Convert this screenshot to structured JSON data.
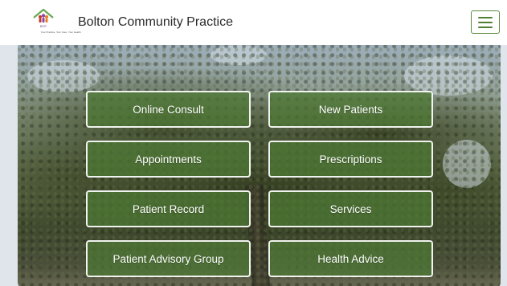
{
  "header": {
    "title": "Bolton Community Practice",
    "logo": {
      "text": "BCP",
      "tagline": "Your Practice. Your Care. Your Health.",
      "icon": "house-with-people-logo"
    },
    "menu_icon": "hamburger-menu-icon"
  },
  "tiles": [
    {
      "label": "Online Consult"
    },
    {
      "label": "New Patients"
    },
    {
      "label": "Appointments"
    },
    {
      "label": "Prescriptions"
    },
    {
      "label": "Patient Record"
    },
    {
      "label": "Services"
    },
    {
      "label": "Patient Advisory Group"
    },
    {
      "label": "Health Advice"
    }
  ],
  "colors": {
    "brand_green": "#5a8a3c",
    "tile_fill": "#4e7a34",
    "tile_border": "#ffffff"
  }
}
